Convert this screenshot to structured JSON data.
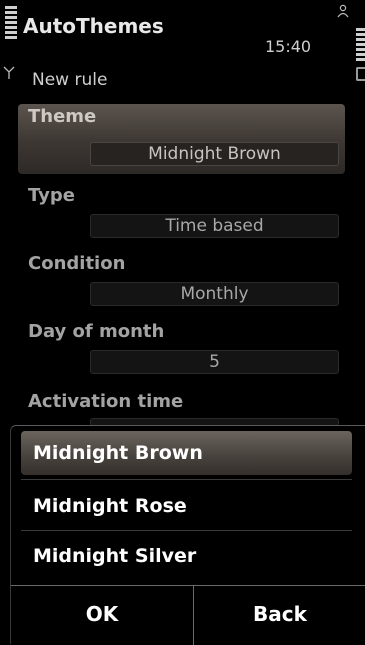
{
  "status": {
    "app_title": "AutoThemes",
    "clock": "15:40",
    "subtitle": "New rule"
  },
  "settings": [
    {
      "label": "Theme",
      "value": "Midnight Brown",
      "highlighted": true
    },
    {
      "label": "Type",
      "value": "Time based"
    },
    {
      "label": "Condition",
      "value": "Monthly"
    },
    {
      "label": "Day of month",
      "value": "5"
    },
    {
      "label": "Activation time",
      "value": ""
    }
  ],
  "popup": {
    "options": [
      "Midnight Brown",
      "Midnight Rose",
      "Midnight Silver"
    ],
    "selected_index": 0,
    "softkeys": {
      "left": "OK",
      "right": "Back"
    }
  },
  "colors": {
    "background": "#000000",
    "highlight": "#4a443f",
    "text": "#ffffff",
    "label": "#a3a3a3"
  }
}
